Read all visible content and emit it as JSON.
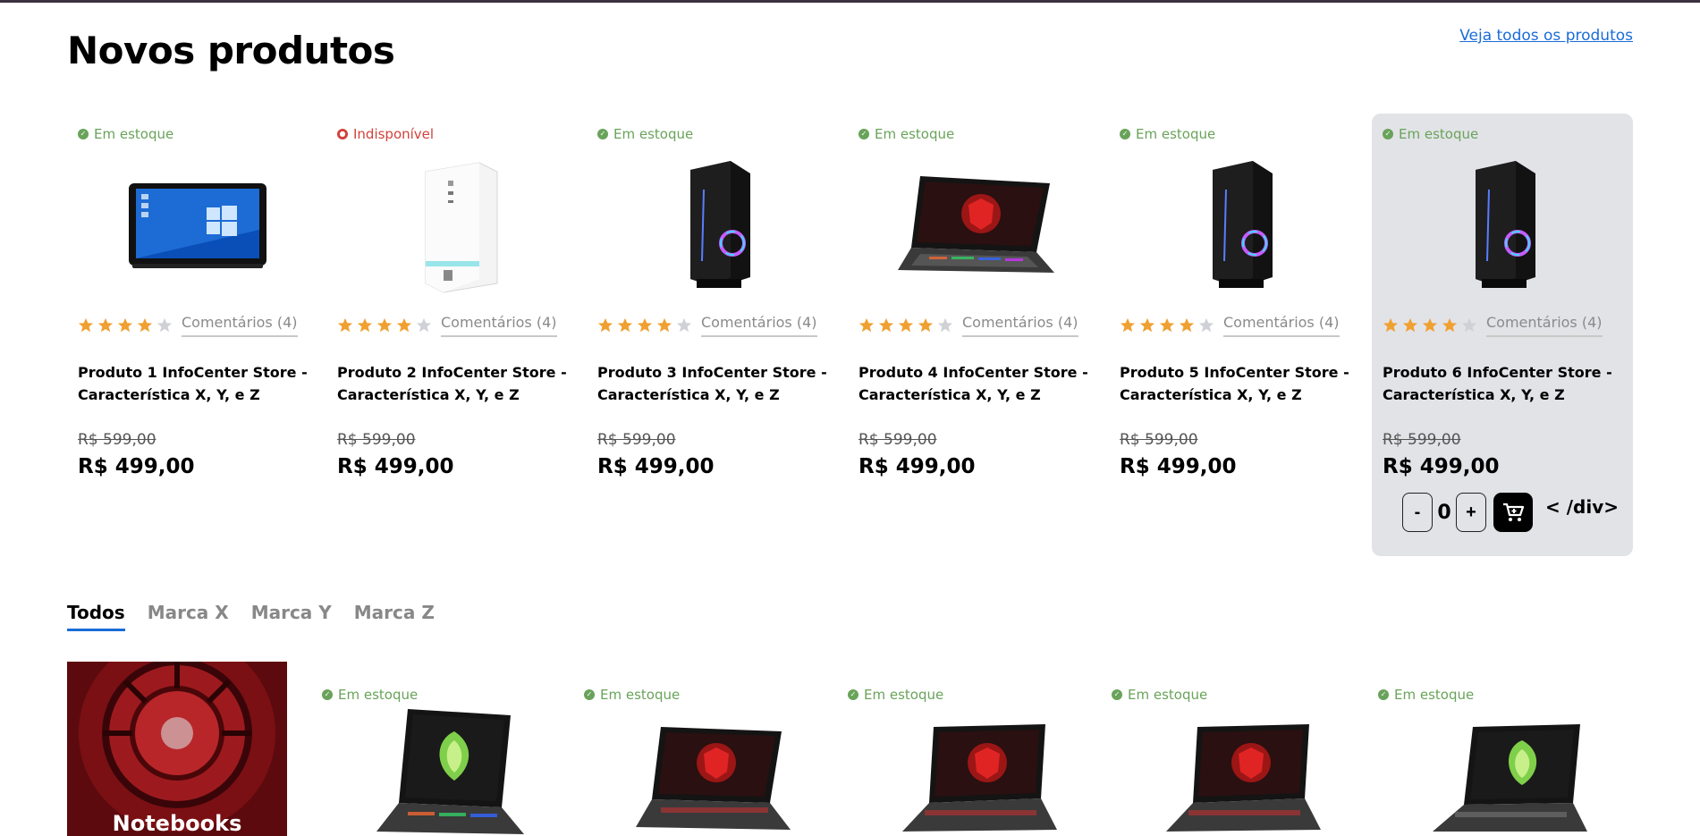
{
  "header": {
    "title": "Novos produtos",
    "view_all_label": "Veja todos os produtos"
  },
  "stock_status": {
    "in": "Em estoque",
    "out": "Indisponível"
  },
  "products": [
    {
      "stock": "Em estoque",
      "rating": 4,
      "comments": "Comentários (4)",
      "name": "Produto 1 InfoCenter Store - Característica X, Y, e Z",
      "old_price": "R$ 599,00",
      "price": "R$ 499,00",
      "image": "all-in-one-pc"
    },
    {
      "stock": "Indisponível",
      "rating": 4,
      "comments": "Comentários (4)",
      "name": "Produto 2 InfoCenter Store - Característica X, Y, e Z",
      "old_price": "R$ 599,00",
      "price": "R$ 499,00",
      "image": "white-tower-pc"
    },
    {
      "stock": "Em estoque",
      "rating": 4,
      "comments": "Comentários (4)",
      "name": "Produto 3 InfoCenter Store - Característica X, Y, e Z",
      "old_price": "R$ 599,00",
      "price": "R$ 499,00",
      "image": "gaming-tower-pc"
    },
    {
      "stock": "Em estoque",
      "rating": 4,
      "comments": "Comentários (4)",
      "name": "Produto 4 InfoCenter Store - Característica X, Y, e Z",
      "old_price": "R$ 599,00",
      "price": "R$ 499,00",
      "image": "gaming-laptop"
    },
    {
      "stock": "Em estoque",
      "rating": 4,
      "comments": "Comentários (4)",
      "name": "Produto 5 InfoCenter Store - Característica X, Y, e Z",
      "old_price": "R$ 599,00",
      "price": "R$ 499,00",
      "image": "gaming-tower-pc"
    },
    {
      "stock": "Em estoque",
      "rating": 4,
      "comments": "Comentários (4)",
      "name": "Produto 6 InfoCenter Store - Característica X, Y, e Z",
      "old_price": "R$ 599,00",
      "price": "R$ 499,00",
      "image": "gaming-tower-pc"
    }
  ],
  "cart": {
    "minus_label": "-",
    "quantity": "0",
    "plus_label": "+",
    "stray_text": "< /div>"
  },
  "tabs": [
    "Todos",
    "Marca X",
    "Marca Y",
    "Marca Z"
  ],
  "active_tab": "Todos",
  "category_banner": {
    "label": "Notebooks"
  },
  "second_row": [
    {
      "stock": "Em estoque",
      "image": "green-dragon-laptop"
    },
    {
      "stock": "Em estoque",
      "image": "red-shield-laptop"
    },
    {
      "stock": "Em estoque",
      "image": "red-shield-laptop"
    },
    {
      "stock": "Em estoque",
      "image": "red-shield-laptop"
    },
    {
      "stock": "Em estoque",
      "image": "green-dragon-laptop"
    }
  ],
  "colors": {
    "accent": "#1a6cd8",
    "star": "#f0a030",
    "in_stock": "#69a35a",
    "out_of_stock": "#d2413b"
  }
}
